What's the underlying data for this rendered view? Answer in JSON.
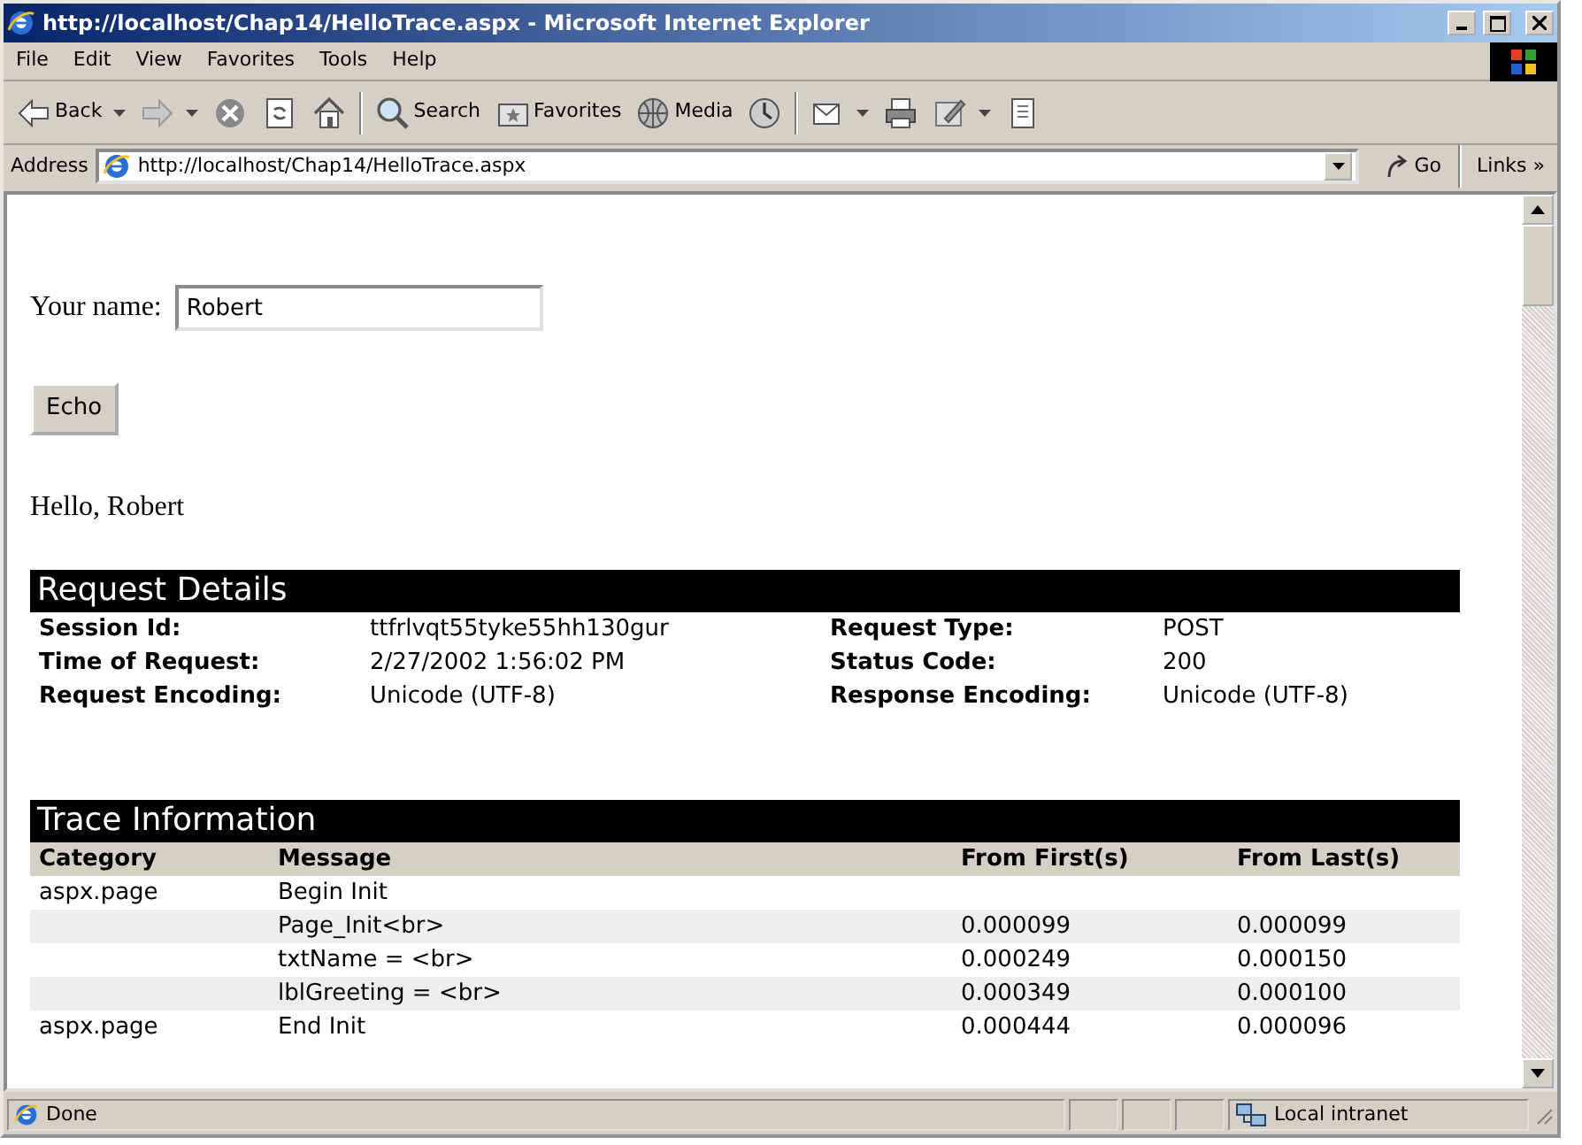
{
  "window": {
    "title": "http://localhost/Chap14/HelloTrace.aspx - Microsoft Internet Explorer"
  },
  "menu": [
    "File",
    "Edit",
    "View",
    "Favorites",
    "Tools",
    "Help"
  ],
  "toolbar": [
    {
      "kind": "back",
      "label": "Back",
      "dropdown": true
    },
    {
      "kind": "forward",
      "dropdown": true
    },
    {
      "kind": "stop"
    },
    {
      "kind": "refresh"
    },
    {
      "kind": "home",
      "separator_after": true
    },
    {
      "kind": "search",
      "label": "Search"
    },
    {
      "kind": "favorites",
      "label": "Favorites"
    },
    {
      "kind": "media",
      "label": "Media"
    },
    {
      "kind": "history",
      "separator_after": true
    },
    {
      "kind": "mail",
      "dropdown": true
    },
    {
      "kind": "print"
    },
    {
      "kind": "edit",
      "dropdown": true
    },
    {
      "kind": "discuss"
    }
  ],
  "address": {
    "label": "Address",
    "value": "http://localhost/Chap14/HelloTrace.aspx",
    "go": "Go",
    "links": "Links",
    "links_more": "»"
  },
  "form": {
    "name_label": "Your name:",
    "name_value": "Robert",
    "button": "Echo",
    "greeting": "Hello, Robert"
  },
  "request_details": {
    "title": "Request Details",
    "fields": [
      {
        "label": "Session Id:",
        "value": "ttfrlvqt55tyke55hh130gur"
      },
      {
        "label": "Request Type:",
        "value": "POST"
      },
      {
        "label": "Time of Request:",
        "value": "2/27/2002 1:56:02 PM"
      },
      {
        "label": "Status Code:",
        "value": "200"
      },
      {
        "label": "Request Encoding:",
        "value": "Unicode (UTF-8)"
      },
      {
        "label": "Response Encoding:",
        "value": "Unicode (UTF-8)"
      }
    ]
  },
  "trace": {
    "title": "Trace Information",
    "columns": [
      "Category",
      "Message",
      "From First(s)",
      "From Last(s)"
    ],
    "rows": [
      [
        "aspx.page",
        "Begin Init",
        "",
        ""
      ],
      [
        "",
        "Page_Init<br>",
        "0.000099",
        "0.000099"
      ],
      [
        "",
        "txtName = <br>",
        "0.000249",
        "0.000150"
      ],
      [
        "",
        "lblGreeting = <br>",
        "0.000349",
        "0.000100"
      ],
      [
        "aspx.page",
        "End Init",
        "0.000444",
        "0.000096"
      ]
    ]
  },
  "status_bar": {
    "text": "Done",
    "zone": "Local intranet"
  }
}
